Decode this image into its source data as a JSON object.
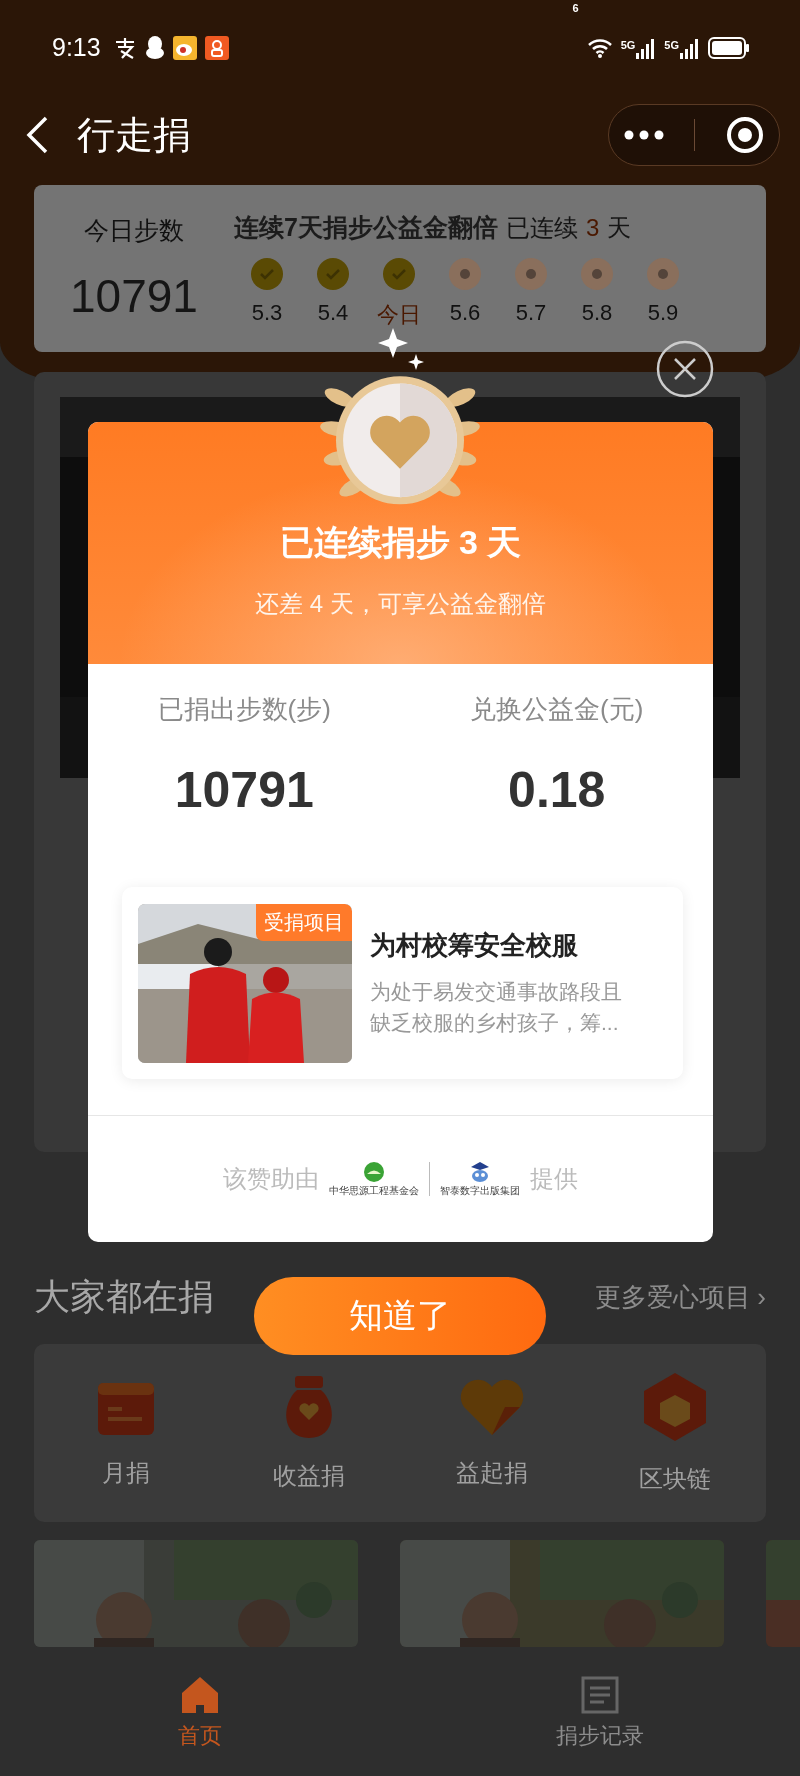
{
  "status_bar": {
    "time": "9:13",
    "wifi_label": "6",
    "signal_labels": [
      "5G",
      "5G"
    ]
  },
  "nav": {
    "title": "行走捐"
  },
  "steps_card": {
    "label": "今日步数",
    "steps": "10791",
    "streak_title": "连续7天捐步公益金翻倍",
    "streak_prefix": "已连续",
    "streak_count": "3",
    "streak_suffix": "天",
    "days": [
      {
        "label": "5.3",
        "checked": true,
        "selected": false
      },
      {
        "label": "5.4",
        "checked": true,
        "selected": false
      },
      {
        "label": "今日",
        "checked": true,
        "selected": true
      },
      {
        "label": "5.6",
        "checked": false,
        "selected": false
      },
      {
        "label": "5.7",
        "checked": false,
        "selected": false
      },
      {
        "label": "5.8",
        "checked": false,
        "selected": false
      },
      {
        "label": "5.9",
        "checked": false,
        "selected": false
      }
    ]
  },
  "section": {
    "title": "大家都在捐",
    "more_link": "更多爱心项目",
    "more_chevron": "›"
  },
  "categories": [
    {
      "label": "月捐",
      "kind": "calendar"
    },
    {
      "label": "收益捐",
      "kind": "bag"
    },
    {
      "label": "益起捐",
      "kind": "heart"
    },
    {
      "label": "区块链",
      "kind": "cube"
    }
  ],
  "tab_bar": [
    {
      "label": "首页",
      "selected": true,
      "kind": "home"
    },
    {
      "label": "捐步记录",
      "selected": false,
      "kind": "record"
    }
  ],
  "dialog": {
    "title": "已连续捐步 3 天",
    "subtitle": "还差 4 天，可享公益金翻倍",
    "stats": [
      {
        "label": "已捐出步数(步)",
        "value": "10791"
      },
      {
        "label": "兑换公益金(元)",
        "value": "0.18"
      }
    ],
    "project": {
      "tag": "受捐项目",
      "title": "为村校筹安全校服",
      "description": "为处于易发交通事故路段且缺乏校服的乡村孩子，筹..."
    },
    "sponsor": {
      "prefix": "该赞助由",
      "logos": [
        {
          "caption": "中华思源工程基金会"
        },
        {
          "caption": "智泰数字出版集团"
        }
      ],
      "suffix": "提供"
    },
    "button": "知道了"
  }
}
